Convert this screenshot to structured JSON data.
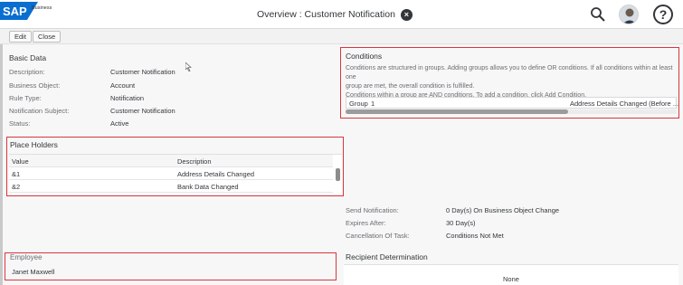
{
  "shell": {
    "logo_text": "SAP",
    "logo_sub": "Business",
    "title": "Overview : Customer Notification",
    "help_glyph": "?"
  },
  "toolbar": {
    "edit_label": "Edit",
    "close_label": "Close"
  },
  "basic_data": {
    "title": "Basic Data",
    "fields": [
      {
        "label": "Description:",
        "value": "Customer Notification"
      },
      {
        "label": "Business Object:",
        "value": "Account"
      },
      {
        "label": "Rule Type:",
        "value": "Notification"
      },
      {
        "label": "Notification Subject:",
        "value": "Customer Notification"
      },
      {
        "label": "Status:",
        "value": "Active"
      }
    ]
  },
  "conditions": {
    "title": "Conditions",
    "text_line1": "Conditions are structured in groups. Adding groups allows you to define OR conditions. If all conditions within at least one",
    "text_line2": "group are met, the overall condition is fulfilled.",
    "text_line3": "Conditions within a group are AND conditions. To add a condition, click Add Condition.",
    "group_label": "Group",
    "group_number": "1",
    "group_condition": "Address Details Changed (Before ..."
  },
  "placeholders": {
    "title": "Place Holders",
    "columns": [
      "Value",
      "Description"
    ],
    "rows": [
      {
        "value": "&1",
        "description": "Address Details Changed"
      },
      {
        "value": "&2",
        "description": "Bank Data Changed"
      }
    ]
  },
  "notification": {
    "fields": [
      {
        "label": "Send Notification:",
        "value": "0 Day(s) On Business Object Change"
      },
      {
        "label": "Expires After:",
        "value": "30 Day(s)"
      },
      {
        "label": "Cancellation Of Task:",
        "value": "Conditions Not Met"
      }
    ]
  },
  "employee": {
    "title": "Employee",
    "name": "Janet Maxwell"
  },
  "recipient": {
    "title": "Recipient Determination",
    "value": "None"
  },
  "colors": {
    "highlight": "#d9363e",
    "sap_blue": "#0a6ed1"
  },
  "icons": [
    "sap-logo",
    "close-icon",
    "search-icon",
    "avatar",
    "help-icon"
  ]
}
